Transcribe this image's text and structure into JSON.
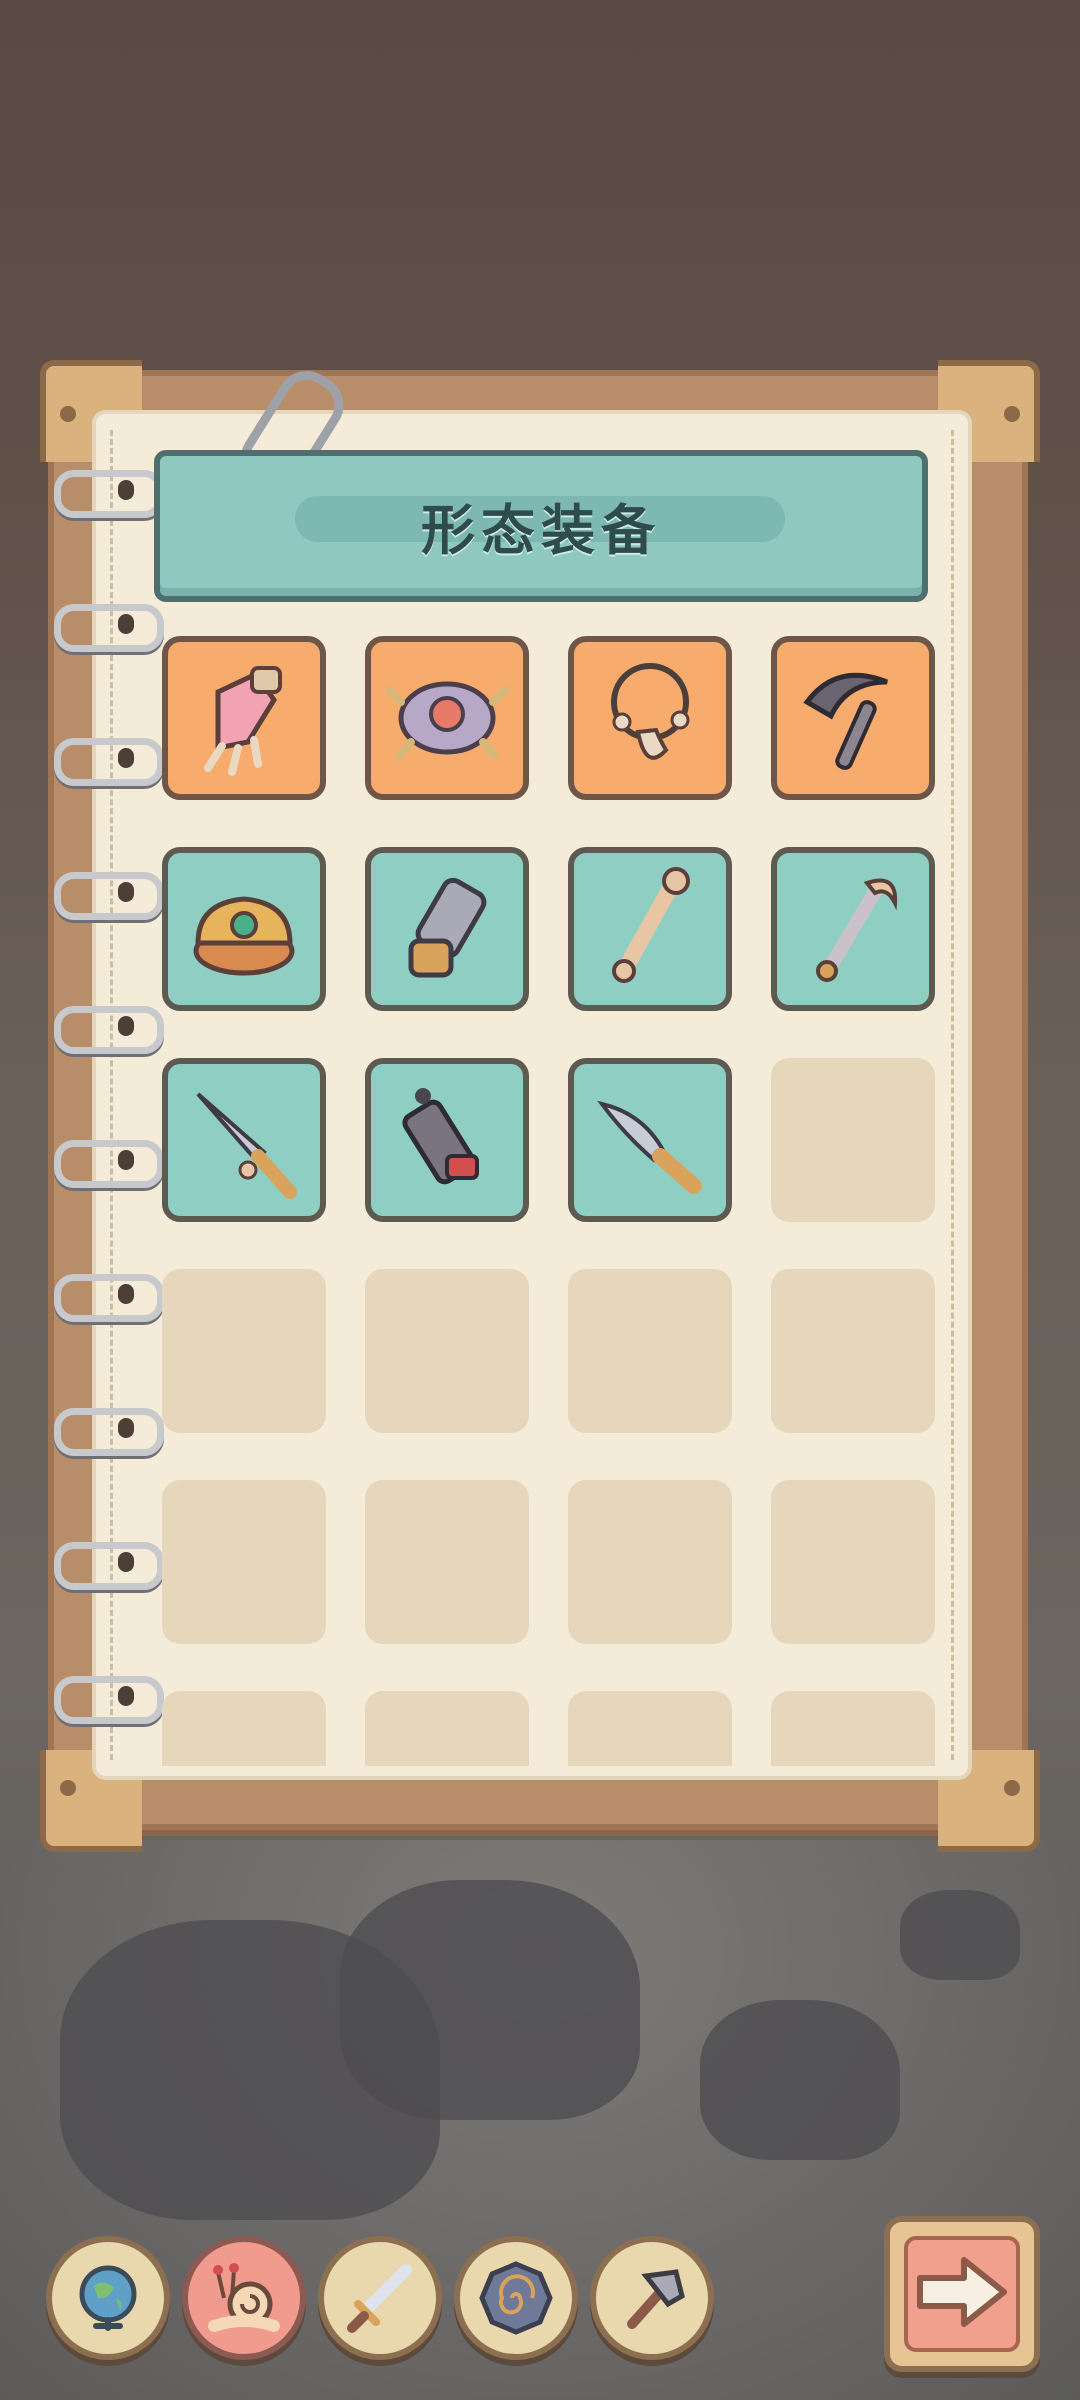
{
  "title": "形态装备",
  "equipment_slots": [
    {
      "icon": "claw-glove-icon",
      "rarity": "orange"
    },
    {
      "icon": "spiked-shell-icon",
      "rarity": "orange"
    },
    {
      "icon": "tooth-necklace-icon",
      "rarity": "orange"
    },
    {
      "icon": "bone-scythe-icon",
      "rarity": "orange"
    },
    {
      "icon": "jeweled-crown-icon",
      "rarity": "teal"
    },
    {
      "icon": "stone-gauntlet-icon",
      "rarity": "teal"
    },
    {
      "icon": "bone-club-icon",
      "rarity": "teal"
    },
    {
      "icon": "horn-staff-icon",
      "rarity": "teal"
    },
    {
      "icon": "bone-dagger-icon",
      "rarity": "teal"
    },
    {
      "icon": "mechanical-blaster-icon",
      "rarity": "teal"
    },
    {
      "icon": "curved-knife-icon",
      "rarity": "teal"
    }
  ],
  "empty_slot_count": 13,
  "nav": [
    {
      "icon": "globe-icon",
      "active": false
    },
    {
      "icon": "snail-icon",
      "active": true
    },
    {
      "icon": "sword-icon",
      "active": false
    },
    {
      "icon": "spiral-shell-icon",
      "active": false
    },
    {
      "icon": "hammer-icon",
      "active": false
    }
  ],
  "next_button_icon": "arrow-right-icon",
  "colors": {
    "orange_slot": "#f7ab6c",
    "teal_slot": "#8fcfc3",
    "empty_slot": "#e5d6bc",
    "banner": "#8fc7c1",
    "paper": "#f4ecd9",
    "active_nav": "#f19b8e"
  }
}
